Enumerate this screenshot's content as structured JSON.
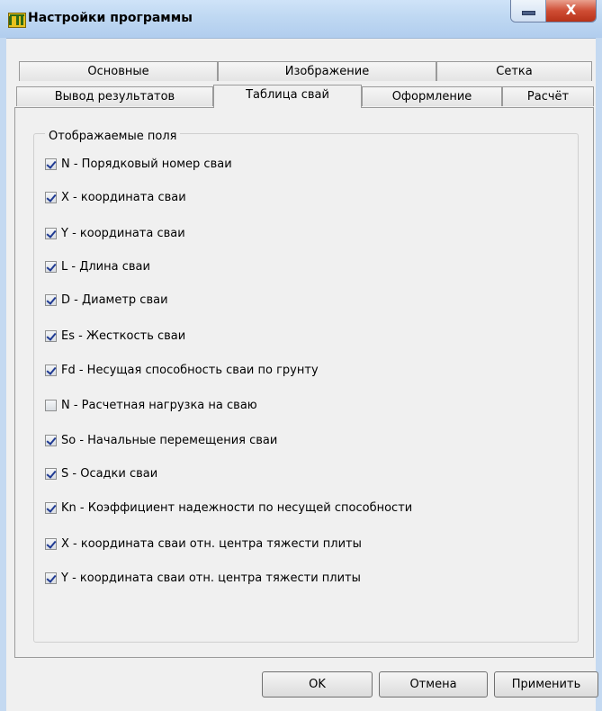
{
  "window": {
    "title": "Настройки программы",
    "close_glyph": "X",
    "colors": {
      "titlebar": "#bfd8f2",
      "close": "#cf4d34",
      "check": "#1f3a93"
    }
  },
  "tabs_row1": [
    {
      "label": "Основные"
    },
    {
      "label": "Изображение"
    },
    {
      "label": "Сетка"
    }
  ],
  "tabs_row2": [
    {
      "label": "Вывод результатов"
    },
    {
      "label": "Таблица свай",
      "active": true
    },
    {
      "label": "Оформление"
    },
    {
      "label": "Расчёт"
    }
  ],
  "group": {
    "title": "Отображаемые поля",
    "fields": [
      {
        "label": "N  - Порядковый номер сваи",
        "checked": true
      },
      {
        "label": "X  - координата сваи",
        "checked": true
      },
      {
        "label": "Y  - координата сваи",
        "checked": true
      },
      {
        "label": "L  - Длина сваи",
        "checked": true
      },
      {
        "label": "D  - Диаметр сваи",
        "checked": true
      },
      {
        "label": "Es - Жесткость сваи",
        "checked": true
      },
      {
        "label": "Fd  - Несущая способность сваи по грунту",
        "checked": true
      },
      {
        "label": "N  - Расчетная нагрузка на сваю",
        "checked": false
      },
      {
        "label": "So - Начальные перемещения сваи",
        "checked": true
      },
      {
        "label": "S  - Осадки сваи",
        "checked": true
      },
      {
        "label": "Kn  - Коэффициент надежности по несущей способности",
        "checked": true
      },
      {
        "label": "X  - координата сваи отн. центра тяжести плиты",
        "checked": true
      },
      {
        "label": "Y  - координата сваи отн. центра тяжести плиты",
        "checked": true
      }
    ]
  },
  "buttons": {
    "ok": "OK",
    "cancel": "Отмена",
    "apply": "Применить"
  }
}
